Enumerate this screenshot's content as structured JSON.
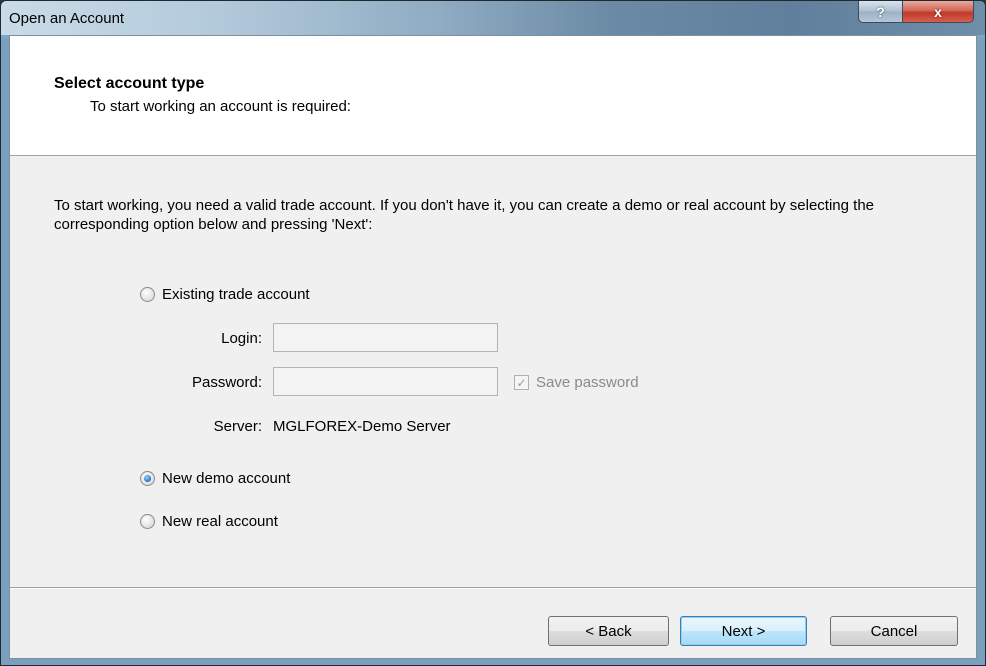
{
  "window": {
    "title": "Open an Account",
    "help_label": "?",
    "close_label": "x"
  },
  "header": {
    "title": "Select account type",
    "subtitle": "To start working an account is required:"
  },
  "intro_text": "To start working, you need a valid trade account. If you don't have it, you can create a demo or real account by selecting the corresponding option below and pressing 'Next':",
  "options": {
    "existing": {
      "label": "Existing trade account",
      "checked": false
    },
    "demo": {
      "label": "New demo account",
      "checked": true
    },
    "real": {
      "label": "New real account",
      "checked": false
    }
  },
  "fields": {
    "login_label": "Login:",
    "login_value": "",
    "password_label": "Password:",
    "password_value": "",
    "save_password_label": "Save password",
    "save_password_checked": true,
    "server_label": "Server:",
    "server_value": "MGLFOREX-Demo Server"
  },
  "buttons": {
    "back": "< Back",
    "next": "Next >",
    "cancel": "Cancel"
  },
  "icons": {
    "check_glyph": "✓"
  }
}
